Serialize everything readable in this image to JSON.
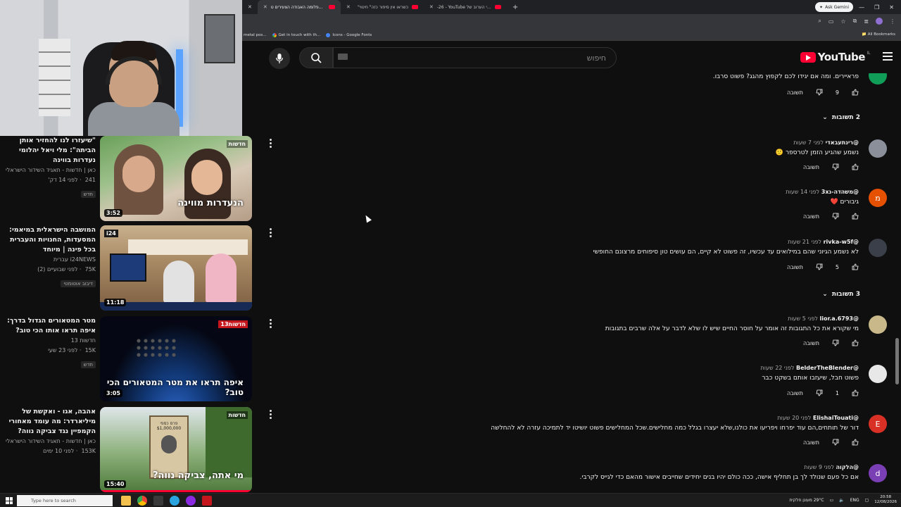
{
  "browser": {
    "tabs": [
      {
        "label": "זוג הפלומה האבודה הצעירים ט",
        "active": true
      },
      {
        "label": "\"כשראו אין סיפור כזה\" חיטוי",
        "active": false
      },
      {
        "label": "-26 - YouTube שידורי הערוב של",
        "active": false
      }
    ],
    "ask_gemini": "Ask Gemini",
    "bookmarks": [
      "metal pos...",
      "Get in touch with th...",
      "Icons - Google Fonts"
    ],
    "all_bookmarks": "All Bookmarks"
  },
  "youtube": {
    "logo_text": "YouTube",
    "region": "IL",
    "search_placeholder": "חיפוש"
  },
  "sidebar_videos": [
    {
      "title": "\"שיעזרו לנו להחזיר אותן הביתה\": מלי ויאל יהלומי נעדרות בווינה",
      "meta1": "כאן | חדשות - תאגיד השידור הישראלי",
      "meta2": "241 ‏‏ · לפני 14 דק'",
      "badge": "חדש",
      "duration": "3:52",
      "overlay": "הנעדרות מווינה",
      "channel_tag": "חדשות"
    },
    {
      "title": "המושבה הישראלית במיאמי: המסעדות, החנויות והעברית בכל פינה | מיוחד",
      "meta1": "i24NEWS עברית",
      "meta2": "75K ‏‏ · לפני שבועיים (2)",
      "badge": "דיבוב אוטומטי",
      "duration": "11:18",
      "overlay": "",
      "channel_tag": "i24"
    },
    {
      "title": "מטר המטאורים הגדול בדרך: איפה תראו אותו הכי טוב?",
      "meta1": "חדשות 13",
      "meta2": "15K ‏‏ · לפני 23 שעי",
      "badge": "חדש",
      "duration": "3:05",
      "overlay": "איפה תראו את מטר המטאורים הכי טוב?",
      "channel_tag": "חדשות13"
    },
    {
      "title": "אהבה, אגו - ואקשת של מיליארדר: מה עומד מאחורי הקמפיין נגד צביקה נווה?",
      "meta1": "כאן | חדשות - תאגיד השידור הישראלי",
      "meta2": "153K ‏‏ · לפני 10 ימים",
      "badge": "",
      "duration": "15:40",
      "overlay": "מי אתה, צביקה נווה?",
      "channel_tag": "חדשות",
      "sign": "פרס כספי $1,000,000"
    }
  ],
  "comments": [
    {
      "type": "partial",
      "text": "פראיירים. ומה אם יגידו לכם לקפוץ מהגג? פשוט סרבו.",
      "likes": "9",
      "reply": "תשובה"
    },
    {
      "type": "toggle",
      "label": "2 תשובות"
    },
    {
      "author": "@רינתעבאדי",
      "time": "לפני 7 שעות",
      "text": "נשמע שהגיע הזמן לטרספר 🙁",
      "likes": "",
      "reply": "תשובה",
      "avatar_color": "#8a8f9a"
    },
    {
      "author": "@משהדה-נ3x",
      "time": "לפני 14 שעות",
      "text": "גיבורים ❤️",
      "likes": "",
      "reply": "תשובה",
      "avatar_color": "#e65100",
      "avatar_letter": "מ"
    },
    {
      "author": "@rivka-w5f",
      "time": "לפני 21 שעות",
      "text": "לא נשמע הגיוני שהם במילואים עד עכשיו, זה פשוט לא קיים, הם עושים טון סיפוחים מרצונם החופשי",
      "likes": "5",
      "reply": "תשובה",
      "avatar_color": "#3a3f4a"
    },
    {
      "type": "toggle",
      "label": "3 תשובות"
    },
    {
      "author": "@lior.a.6793",
      "time": "לפני 5 שעות",
      "text": "מי שקורא את כל התגובות זה אומר על חוסר החיים שיש לו שלא לדבר על אלה שרבים בתגובות",
      "likes": "",
      "reply": "תשובה",
      "avatar_color": "#c9b98a"
    },
    {
      "author": "@BelderTheBlender",
      "time": "לפני 22 שעות",
      "text": "פשוט חבל, שיעזבו אותם בשקט כבר",
      "likes": "1",
      "reply": "תשובה",
      "avatar_color": "#e8e8e8"
    },
    {
      "author": "@ElishaiTouati",
      "time": "לפני 20 שעות",
      "text": "דור של תותחים,הם עוד יפרחו ויפריעו את כולנו,שלא יעצרו בגלל כמה מחלישים.שכל המחלישים פשוט יושיטו יד לתמיכה עזרה לא להחלשה",
      "likes": "",
      "reply": "תשובה",
      "avatar_color": "#d93025",
      "avatar_letter": "E"
    },
    {
      "author": "@הלקוה",
      "time": "לפני 9 שעות",
      "text": "אם כל פעם שנולד לך בן תחליף אישה, ככה כולם יהיו בנים יחידים שחייבים אישור מהאם כדי לגייס לקרבי.",
      "likes": "",
      "reply": "",
      "avatar_color": "#7b3fb5",
      "avatar_letter": "d"
    }
  ],
  "taskbar": {
    "search_placeholder": "Type here to search",
    "weather": "29°C  מעונן חלקית",
    "lang": "ENG",
    "time": "20:58",
    "date": "12/08/2026"
  }
}
